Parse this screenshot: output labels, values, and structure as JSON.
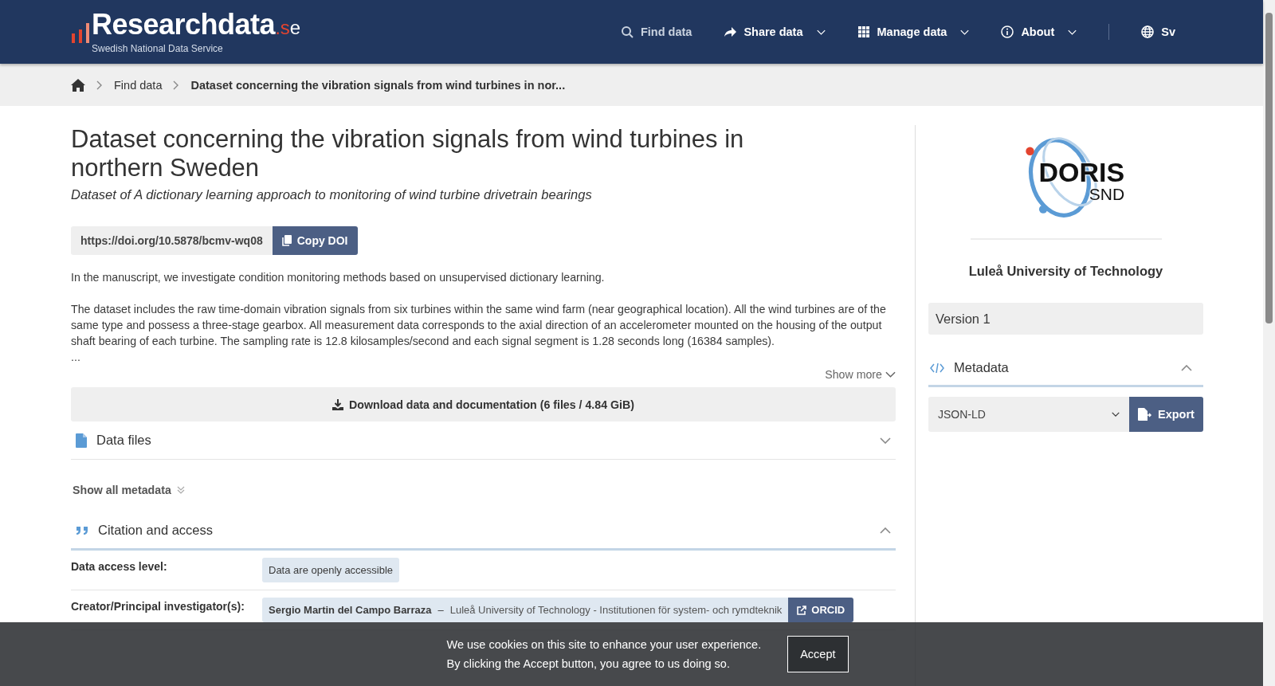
{
  "header": {
    "logo": {
      "name": "Researchdata",
      "suffix": ".se",
      "tagline": "Swedish National Data Service"
    },
    "nav": [
      {
        "label": "Find data",
        "dropdown": false,
        "selected": true
      },
      {
        "label": "Share data",
        "dropdown": true,
        "selected": false
      },
      {
        "label": "Manage data",
        "dropdown": true,
        "selected": false
      },
      {
        "label": "About",
        "dropdown": true,
        "selected": false
      }
    ],
    "language": "Sv"
  },
  "breadcrumb": [
    "Find data",
    "Dataset concerning the vibration signals from wind turbines in nor..."
  ],
  "dataset": {
    "title": "Dataset concerning the vibration signals from wind turbines in northern Sweden",
    "subtitle": "Dataset of A dictionary learning approach to monitoring of wind turbine drivetrain bearings",
    "doi": "https://doi.org/10.5878/bcmv-wq08",
    "copy_button": "Copy DOI",
    "description": [
      "In the manuscript, we investigate condition monitoring methods based on unsupervised dictionary learning.",
      "The dataset includes the raw time-domain vibration signals from six turbines within the same wind farm (near geographical location). All the wind turbines are of the same type and possess a three-stage gearbox. All measurement data corresponds to the axial direction of an accelerometer mounted on the housing of the output shaft bearing of each turbine. The sampling rate is 12.8 kilosamples/second and each signal segment is 1.28 seconds long (16384 samples).",
      "..."
    ],
    "show_more": "Show more",
    "download_button": "Download data and documentation (6 files / 4.84 GiB)",
    "sections": [
      {
        "title": "Data files",
        "expanded": false
      }
    ],
    "show_all_metadata": "Show all metadata",
    "citation": {
      "title": "Citation and access",
      "expanded": true,
      "fields": [
        {
          "label": "Data access level:",
          "kind": "tag",
          "values": [
            {
              "text": "Data are openly accessible"
            }
          ]
        },
        {
          "label": "Creator/Principal investigator(s):",
          "kind": "person",
          "values": [
            {
              "name": "Sergio Martin del Campo Barraza",
              "separator": "–",
              "affiliation": "Luleå University of Technology - Institutionen för system- och rymdteknik",
              "link": "ORCID"
            }
          ]
        }
      ]
    }
  },
  "sidebar": {
    "logo": {
      "name": "DORIS",
      "sub": "SND"
    },
    "organization": "Luleå University of Technology",
    "version": "Version 1",
    "metadata": {
      "title": "Metadata",
      "expanded": true,
      "format": "JSON-LD",
      "export_button": "Export"
    }
  },
  "cookie_banner": {
    "lines": [
      "We use cookies on this site to enhance your user experience.",
      "By clicking the Accept button, you agree to us doing so."
    ],
    "accept_button": "Accept"
  }
}
